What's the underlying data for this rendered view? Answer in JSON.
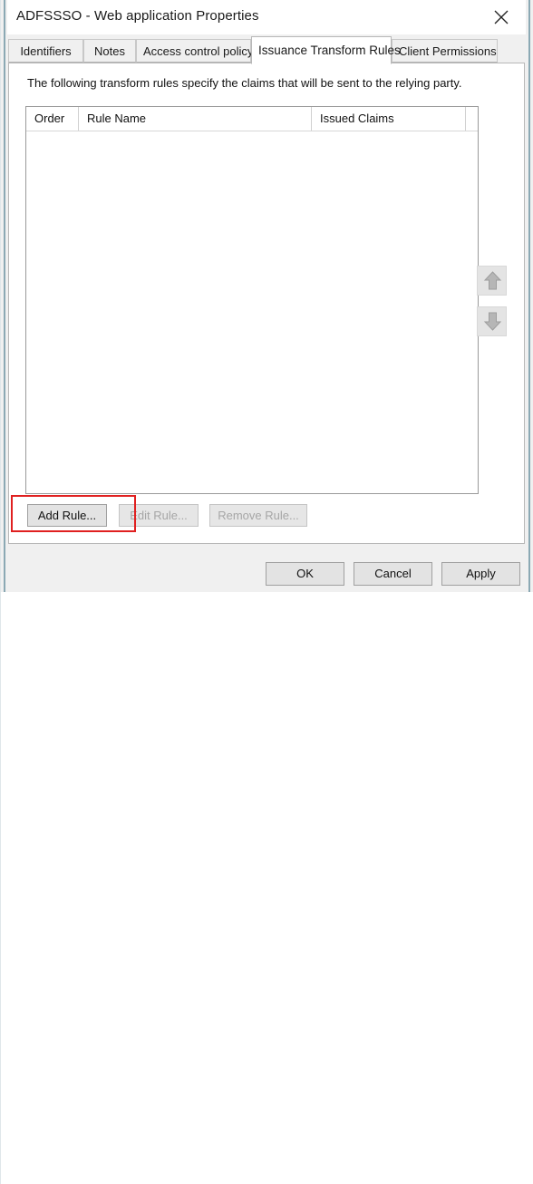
{
  "window": {
    "title": "ADFSSSO - Web application Properties",
    "close_icon": "close-icon"
  },
  "tabs": [
    {
      "label": "Identifiers",
      "active": false
    },
    {
      "label": "Notes",
      "active": false
    },
    {
      "label": "Access control policy",
      "active": false
    },
    {
      "label": "Issuance Transform Rules",
      "active": true
    },
    {
      "label": "Client Permissions",
      "active": false
    }
  ],
  "main": {
    "description": "The following transform rules specify the claims that will be sent to the relying party.",
    "list": {
      "columns": [
        "Order",
        "Rule Name",
        "Issued Claims"
      ],
      "rows": []
    },
    "reorder": {
      "move_up_icon": "arrow-up-icon",
      "move_down_icon": "arrow-down-icon"
    },
    "buttons": {
      "add_rule": "Add Rule...",
      "edit_rule": "Edit Rule...",
      "remove_rule": "Remove Rule..."
    }
  },
  "footer": {
    "ok": "OK",
    "cancel": "Cancel",
    "apply": "Apply"
  },
  "annotation": {
    "highlight_color": "#e02020",
    "target": "add-rule-button"
  }
}
